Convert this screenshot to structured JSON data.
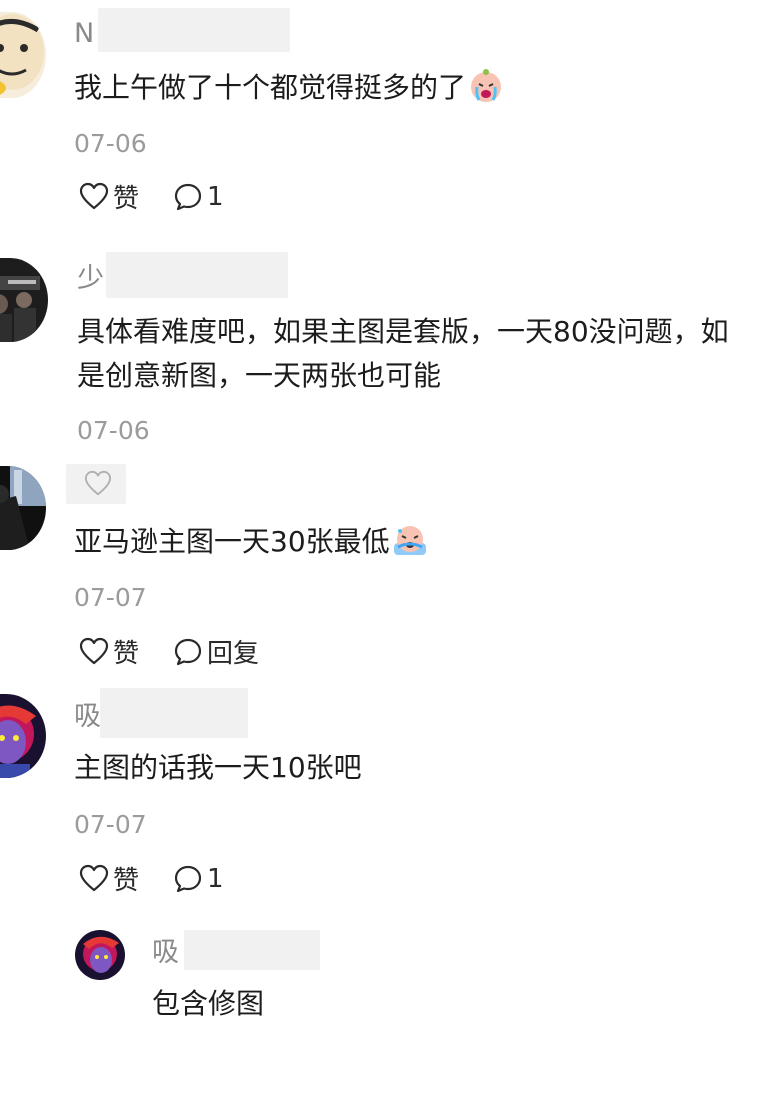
{
  "comments": [
    {
      "name_visible": "N",
      "text": "我上午做了十个都觉得挺多的了",
      "emoji": "crying-face-emoji",
      "date": "07-06",
      "like_label": "赞",
      "reply_label": "1"
    },
    {
      "name_visible": "少",
      "text_line1": "具体看难度吧，如果主图是套版，一天80没问题，如",
      "text_line2": "是创意新图，一天两张也可能",
      "date": "07-06"
    },
    {
      "name_visible": "",
      "text": "亚马逊主图一天30张最低",
      "emoji": "sweating-face-emoji",
      "date": "07-07",
      "like_label": "赞",
      "reply_label": "回复"
    },
    {
      "name_visible": "吸",
      "text": "主图的话我一天10张吧",
      "date": "07-07",
      "like_label": "赞",
      "reply_label": "1"
    }
  ],
  "reply": {
    "name_visible": "吸",
    "text": "包含修图"
  },
  "colors": {
    "text": "#1c1c1c",
    "meta": "#9b9b9b",
    "name": "#8a8a8a"
  },
  "icons": [
    "heart-outline-icon",
    "comment-bubble-icon"
  ]
}
